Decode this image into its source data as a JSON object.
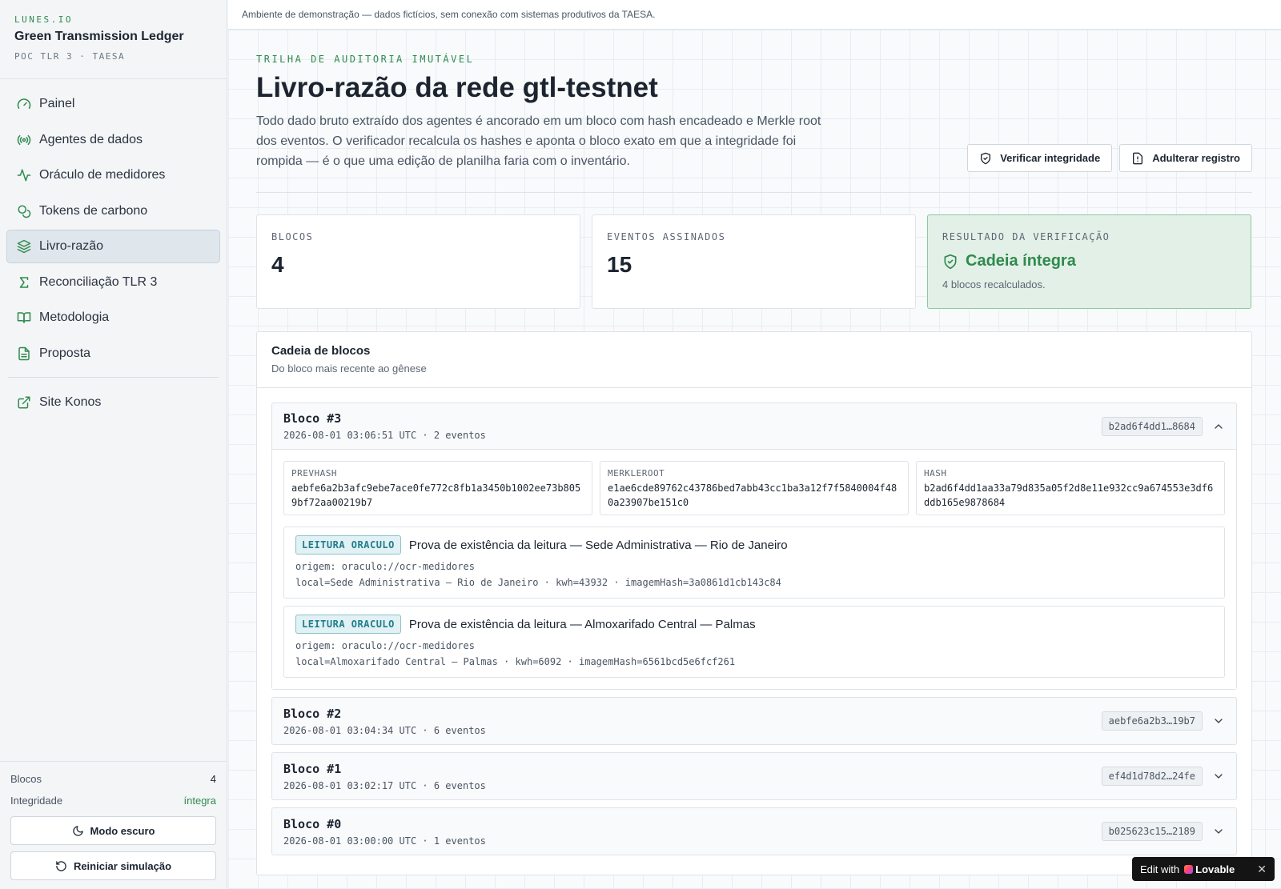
{
  "brand": {
    "kicker": "LUNES.IO",
    "title": "Green Transmission Ledger",
    "subtitle": "POC TLR 3 · TAESA"
  },
  "nav": {
    "items": [
      {
        "label": "Painel",
        "icon": "gauge-icon"
      },
      {
        "label": "Agentes de dados",
        "icon": "radio-icon"
      },
      {
        "label": "Oráculo de medidores",
        "icon": "activity-icon"
      },
      {
        "label": "Tokens de carbono",
        "icon": "coins-icon"
      },
      {
        "label": "Livro-razão",
        "icon": "layers-icon",
        "active": true
      },
      {
        "label": "Reconciliação TLR 3",
        "icon": "sigma-icon"
      },
      {
        "label": "Metodologia",
        "icon": "book-icon"
      },
      {
        "label": "Proposta",
        "icon": "file-text-icon"
      }
    ],
    "external": {
      "label": "Site Konos",
      "icon": "external-link-icon"
    }
  },
  "sidebar_footer": {
    "blocks_label": "Blocos",
    "blocks_value": "4",
    "integrity_label": "Integridade",
    "integrity_value": "íntegra",
    "dark_mode_label": "Modo escuro",
    "reset_label": "Reiniciar simulação"
  },
  "banner": "Ambiente de demonstração — dados fictícios, sem conexão com sistemas produtivos da TAESA.",
  "header": {
    "kicker": "TRILHA DE AUDITORIA IMUTÁVEL",
    "title": "Livro-razão da rede gtl-testnet",
    "description": "Todo dado bruto extraído dos agentes é ancorado em um bloco com hash encadeado e Merkle root dos eventos. O verificador recalcula os hashes e aponta o bloco exato em que a integridade foi rompida — é o que uma edição de planilha faria com o inventário.",
    "verify_label": "Verificar integridade",
    "tamper_label": "Adulterar registro"
  },
  "stats": {
    "blocks_label": "BLOCOS",
    "blocks_value": "4",
    "events_label": "EVENTOS ASSINADOS",
    "events_value": "15",
    "result_label": "RESULTADO DA VERIFICAÇÃO",
    "result_title": "Cadeia íntegra",
    "result_sub": "4 blocos recalculados."
  },
  "chain": {
    "title": "Cadeia de blocos",
    "subtitle": "Do bloco mais recente ao gênese",
    "blocks": [
      {
        "title": "Bloco #3",
        "meta": "2026-08-01 03:06:51 UTC · 2 eventos",
        "hash_short": "b2ad6f4dd1…8684",
        "open": true,
        "prevhash_label": "PREVHASH",
        "prevhash": "aebfe6a2b3afc9ebe7ace0fe772c8fb1a3450b1002ee73b8059bf72aa00219b7",
        "merkleroot_label": "MERKLEROOT",
        "merkleroot": "e1ae6cde89762c43786bed7abb43cc1ba3a12f7f5840004f480a23907be151c0",
        "hash_label": "HASH",
        "hash": "b2ad6f4dd1aa33a79d835a05f2d8e11e932cc9a674553e3df6ddb165e9878684",
        "events": [
          {
            "badge": "LEITURA ORACULO",
            "title": "Prova de existência da leitura — Sede Administrativa — Rio de Janeiro",
            "origin": "origem: oraculo://ocr-medidores",
            "detail": "local=Sede Administrativa — Rio de Janeiro · kwh=43932 · imagemHash=3a0861d1cb143c84"
          },
          {
            "badge": "LEITURA ORACULO",
            "title": "Prova de existência da leitura — Almoxarifado Central — Palmas",
            "origin": "origem: oraculo://ocr-medidores",
            "detail": "local=Almoxarifado Central — Palmas · kwh=6092 · imagemHash=6561bcd5e6fcf261"
          }
        ]
      },
      {
        "title": "Bloco #2",
        "meta": "2026-08-01 03:04:34 UTC · 6 eventos",
        "hash_short": "aebfe6a2b3…19b7"
      },
      {
        "title": "Bloco #1",
        "meta": "2026-08-01 03:02:17 UTC · 6 eventos",
        "hash_short": "ef4d1d78d2…24fe"
      },
      {
        "title": "Bloco #0",
        "meta": "2026-08-01 03:00:00 UTC · 1 eventos",
        "hash_short": "b025623c15…2189"
      }
    ]
  },
  "lovable": {
    "prefix": "Edit with",
    "brand": "Lovable",
    "close": "✕"
  }
}
